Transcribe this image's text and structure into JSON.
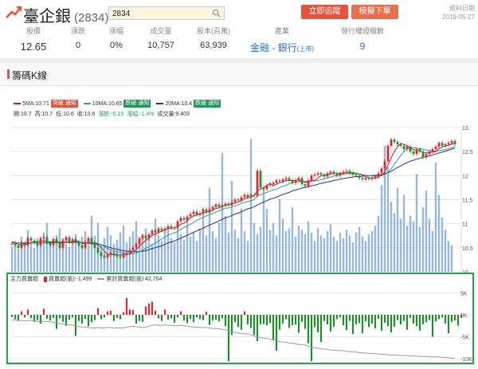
{
  "header": {
    "stock_name": "臺企銀",
    "stock_code": "(2834)",
    "search_value": "2834",
    "track_button": "立即追蹤",
    "trade_button": "模擬下單",
    "data_date_label": "資料日期",
    "data_date": "2019-05-27"
  },
  "stats": [
    {
      "label": "股價",
      "value": "12.65"
    },
    {
      "label": "漲跌",
      "value": "0"
    },
    {
      "label": "漲幅",
      "value": "0%"
    },
    {
      "label": "成交量",
      "value": "10,757"
    },
    {
      "label": "股本(百萬)",
      "value": "63,939"
    }
  ],
  "industry": {
    "label": "產業",
    "sector": "金融",
    "sep": " - ",
    "sub": "銀行",
    "market": "(上市)"
  },
  "warrants": {
    "label": "發行權證檔數",
    "value": "9"
  },
  "section_title": "籌碼K線",
  "legend": {
    "ma5": "5MA:10.71",
    "ma5_tag": "突破 通知",
    "ma10": "10MA:10.65",
    "ma10_tag": "跌破 通知",
    "ma20": "20MA:10.4",
    "ma20_tag": "跌破 通知"
  },
  "info": {
    "open": "開:10.7",
    "high": "高:10.7",
    "low": "低:10.6",
    "close": "收:10.6",
    "change": "漲跌:-0.15",
    "pct": "漲幅:-1.4%",
    "volume": "成交量:9,403"
  },
  "bottom_legend": {
    "main": "主力買賣超",
    "daily": "買賣超(張):-1,499",
    "cumulative": "累計買賣超(張):42,704"
  },
  "colors": {
    "up": "#e3262d",
    "down": "#1f8f2e",
    "ma5": "#b22222",
    "ma10": "#2fa29a",
    "ma20": "#2a2d9a",
    "volume": "#9ab8d8",
    "frame": "#22a447",
    "brand": "#e5533d"
  },
  "chart_data": {
    "type": "candlestick",
    "price_axis": {
      "ticks": [
        "13",
        "12.5",
        "12",
        "11.5",
        "11",
        "10.5",
        "10"
      ],
      "ylim": [
        10,
        13
      ]
    },
    "flow_axis": {
      "ticks": [
        "5K",
        "0K",
        "-5K",
        "-10K"
      ],
      "ylim": [
        -10000,
        6000
      ]
    },
    "close": [
      10.58,
      10.55,
      10.5,
      10.6,
      10.55,
      10.7,
      10.65,
      10.6,
      10.55,
      10.7,
      10.72,
      10.6,
      10.55,
      10.68,
      10.6,
      10.5,
      10.65,
      10.72,
      10.6,
      10.68,
      10.62,
      10.55,
      10.5,
      10.62,
      10.7,
      10.6,
      10.5,
      10.4,
      10.33,
      10.3,
      10.35,
      10.4,
      10.36,
      10.32,
      10.3,
      10.38,
      10.4,
      10.45,
      10.5,
      10.58,
      10.7,
      10.75,
      10.7,
      10.78,
      10.86,
      10.82,
      10.9,
      10.86,
      10.9,
      10.95,
      10.9,
      10.92,
      11.05,
      11.12,
      11.08,
      11.15,
      11.2,
      11.25,
      11.18,
      11.22,
      11.3,
      11.25,
      11.3,
      11.35,
      11.4,
      11.35,
      11.38,
      11.42,
      11.4,
      11.45,
      11.5,
      11.48,
      11.55,
      11.6,
      11.55,
      11.6,
      11.58,
      12.1,
      11.75,
      11.72,
      11.8,
      11.82,
      11.85,
      11.9,
      11.88,
      11.92,
      11.95,
      11.9,
      11.85,
      11.9,
      11.95,
      11.82,
      11.78,
      11.9,
      12.0,
      12.02,
      12.05,
      12.02,
      11.98,
      12.05,
      12.08,
      12.05,
      12.0,
      12.05,
      12.08,
      12.1,
      12.06,
      12.02,
      12.0,
      11.95,
      11.92,
      11.95,
      11.93,
      11.95,
      11.98,
      12.05,
      12.15,
      12.3,
      12.62,
      12.75,
      12.7,
      12.65,
      12.62,
      12.55,
      12.6,
      12.5,
      12.45,
      12.55,
      12.5,
      12.38,
      12.45,
      12.5,
      12.55,
      12.6,
      12.68,
      12.62,
      12.65,
      12.68,
      12.72,
      12.65
    ],
    "volume_k": [
      1.8,
      2.2,
      1.6,
      2.5,
      1.9,
      3.0,
      2.1,
      1.7,
      2.4,
      2.0,
      2.8,
      3.5,
      2.2,
      1.9,
      2.6,
      3.1,
      2.4,
      2.0,
      1.8,
      2.3,
      2.7,
      2.1,
      2.5,
      2.9,
      2.2,
      4.0,
      2.6,
      3.5,
      2.0,
      2.4,
      3.2,
      2.6,
      2.0,
      2.3,
      2.8,
      3.3,
      2.1,
      2.5,
      2.9,
      3.6,
      2.2,
      2.7,
      3.1,
      2.4,
      2.0,
      3.8,
      2.6,
      2.2,
      2.9,
      3.0,
      2.4,
      2.1,
      3.4,
      2.7,
      2.3,
      3.9,
      2.5,
      2.8,
      2.2,
      3.1,
      4.2,
      2.6,
      6.0,
      2.9,
      2.4,
      3.5,
      8.5,
      4.0,
      2.8,
      6.5,
      3.0,
      2.4,
      4.5,
      2.9,
      2.2,
      9.5,
      3.5,
      2.7,
      3.2,
      6.0,
      4.5,
      3.0,
      3.5,
      2.6,
      5.2,
      3.8,
      2.9,
      3.1,
      4.6,
      2.5,
      3.3,
      3.0,
      2.7,
      3.6,
      2.8,
      2.2,
      3.1,
      2.6,
      2.4,
      2.9,
      3.4,
      2.5,
      2.2,
      2.8,
      2.4,
      3.0,
      2.6,
      2.1,
      2.8,
      3.2,
      2.5,
      2.2,
      2.7,
      2.9,
      3.3,
      4.0,
      6.2,
      9.0,
      7.5,
      5.0,
      4.2,
      6.0,
      3.8,
      5.5,
      3.3,
      4.0,
      3.6,
      7.0,
      3.2,
      4.6,
      5.8,
      3.8,
      2.9,
      7.8,
      5.5,
      3.9,
      3.0,
      2.2,
      1.9
    ],
    "ma5": [
      10.62,
      10.6,
      10.57,
      10.56,
      10.56,
      10.58,
      10.61,
      10.62,
      10.63,
      10.64,
      10.64,
      10.63,
      10.62,
      10.63,
      10.63,
      10.59,
      10.6,
      10.62,
      10.61,
      10.63,
      10.65,
      10.63,
      10.59,
      10.59,
      10.6,
      10.58,
      10.58,
      10.56,
      10.51,
      10.43,
      10.36,
      10.36,
      10.35,
      10.35,
      10.35,
      10.35,
      10.35,
      10.38,
      10.42,
      10.46,
      10.53,
      10.6,
      10.65,
      10.7,
      10.76,
      10.78,
      10.82,
      10.84,
      10.87,
      10.9,
      10.91,
      10.91,
      10.94,
      10.99,
      11.01,
      11.06,
      11.12,
      11.16,
      11.18,
      11.2,
      11.23,
      11.24,
      11.25,
      11.28,
      11.32,
      11.33,
      11.36,
      11.38,
      11.39,
      11.4,
      11.43,
      11.45,
      11.48,
      11.52,
      11.54,
      11.56,
      11.58,
      11.69,
      11.72,
      11.75,
      11.79,
      11.84,
      11.79,
      11.82,
      11.85,
      11.87,
      11.9,
      11.9,
      11.9,
      11.9,
      11.91,
      11.88,
      11.86,
      11.87,
      11.89,
      11.9,
      11.95,
      12.0,
      12.01,
      12.02,
      12.04,
      12.04,
      12.04,
      12.05,
      12.05,
      12.06,
      12.06,
      12.06,
      12.05,
      12.03,
      12.01,
      11.98,
      11.95,
      11.95,
      11.95,
      11.97,
      12.01,
      12.07,
      12.22,
      12.37,
      12.5,
      12.6,
      12.67,
      12.65,
      12.62,
      12.58,
      12.54,
      12.53,
      12.52,
      12.48,
      12.47,
      12.48,
      12.49,
      12.5,
      12.56,
      12.59,
      12.62,
      12.63,
      12.66,
      12.66
    ],
    "ma10": [
      10.62,
      10.61,
      10.6,
      10.59,
      10.58,
      10.59,
      10.6,
      10.6,
      10.6,
      10.6,
      10.61,
      10.61,
      10.62,
      10.63,
      10.63,
      10.62,
      10.62,
      10.62,
      10.62,
      10.62,
      10.62,
      10.62,
      10.6,
      10.6,
      10.61,
      10.61,
      10.61,
      10.59,
      10.56,
      10.52,
      10.48,
      10.46,
      10.44,
      10.42,
      10.41,
      10.39,
      10.37,
      10.37,
      10.38,
      10.39,
      10.42,
      10.45,
      10.49,
      10.52,
      10.56,
      10.6,
      10.64,
      10.68,
      10.72,
      10.76,
      10.79,
      10.81,
      10.84,
      10.88,
      10.92,
      10.95,
      10.99,
      11.03,
      11.07,
      11.1,
      11.13,
      11.16,
      11.19,
      11.21,
      11.24,
      11.27,
      11.29,
      11.32,
      11.33,
      11.35,
      11.37,
      11.39,
      11.42,
      11.44,
      11.46,
      11.48,
      11.5,
      11.58,
      11.6,
      11.63,
      11.65,
      11.68,
      11.7,
      11.72,
      11.75,
      11.78,
      11.8,
      11.83,
      11.85,
      11.86,
      11.88,
      11.88,
      11.88,
      11.89,
      11.89,
      11.89,
      11.9,
      11.92,
      11.93,
      11.95,
      11.97,
      11.99,
      12.0,
      12.02,
      12.03,
      12.04,
      12.04,
      12.04,
      12.04,
      12.03,
      12.02,
      12.01,
      12.0,
      11.99,
      11.99,
      11.99,
      12.0,
      12.02,
      12.07,
      12.14,
      12.24,
      12.33,
      12.42,
      12.5,
      12.56,
      12.58,
      12.58,
      12.57,
      12.56,
      12.55,
      12.53,
      12.52,
      12.51,
      12.51,
      12.52,
      12.53,
      12.54,
      12.56,
      12.58,
      12.6
    ],
    "ma20": [
      10.6,
      10.6,
      10.6,
      10.6,
      10.6,
      10.6,
      10.6,
      10.6,
      10.6,
      10.6,
      10.6,
      10.6,
      10.6,
      10.6,
      10.61,
      10.61,
      10.61,
      10.61,
      10.61,
      10.61,
      10.61,
      10.61,
      10.61,
      10.61,
      10.6,
      10.6,
      10.59,
      10.58,
      10.56,
      10.54,
      10.52,
      10.5,
      10.48,
      10.47,
      10.45,
      10.44,
      10.43,
      10.42,
      10.42,
      10.42,
      10.42,
      10.43,
      10.44,
      10.46,
      10.48,
      10.5,
      10.52,
      10.54,
      10.57,
      10.6,
      10.62,
      10.64,
      10.67,
      10.7,
      10.73,
      10.76,
      10.79,
      10.82,
      10.85,
      10.88,
      10.91,
      10.94,
      10.97,
      11.0,
      11.03,
      11.06,
      11.09,
      11.12,
      11.14,
      11.17,
      11.2,
      11.22,
      11.25,
      11.28,
      11.31,
      11.33,
      11.35,
      11.39,
      11.42,
      11.45,
      11.48,
      11.51,
      11.53,
      11.55,
      11.58,
      11.61,
      11.63,
      11.65,
      11.68,
      11.7,
      11.72,
      11.74,
      11.75,
      11.77,
      11.79,
      11.8,
      11.82,
      11.84,
      11.85,
      11.87,
      11.88,
      11.9,
      11.91,
      11.93,
      11.94,
      11.95,
      11.96,
      11.97,
      11.98,
      11.98,
      11.99,
      11.99,
      12.0,
      12.0,
      12.01,
      12.01,
      12.02,
      12.04,
      12.06,
      12.09,
      12.13,
      12.17,
      12.2,
      12.24,
      12.27,
      12.3,
      12.32,
      12.34,
      12.36,
      12.38,
      12.39,
      12.41,
      12.43,
      12.45,
      12.47,
      12.49,
      12.51,
      12.53,
      12.55,
      12.57
    ],
    "flow_k": [
      -0.5,
      -1.0,
      -1.4,
      0.8,
      -0.6,
      1.2,
      -0.8,
      -1.6,
      -1.2,
      -2.0,
      1.4,
      -0.9,
      -1.3,
      -0.7,
      -3.2,
      -0.8,
      -1.6,
      -2.5,
      -1.1,
      -0.6,
      -4.8,
      -1.4,
      -2.0,
      -0.9,
      -2.6,
      -1.7,
      -1.2,
      1.5,
      -1.0,
      -0.6,
      0.8,
      0.9,
      -1.4,
      -0.7,
      -1.0,
      0.6,
      3.8,
      1.2,
      1.1,
      -2.0,
      -1.4,
      -1.6,
      1.9,
      2.6,
      3.0,
      0.9,
      -0.8,
      -1.4,
      1.2,
      -1.1,
      -0.8,
      -1.8,
      -0.6,
      0.8,
      -1.3,
      -1.9,
      -0.9,
      -1.7,
      -0.6,
      -1.0,
      -1.2,
      0.7,
      -2.3,
      -1.3,
      -1.1,
      -1.5,
      -0.8,
      -2.6,
      -10.6,
      -4.6,
      -1.7,
      -2.8,
      -3.4,
      0.8,
      -2.2,
      -3.0,
      -4.6,
      -6.0,
      -2.2,
      -2.1,
      -2.4,
      -1.9,
      -5.8,
      -8.2,
      -3.4,
      -2.0,
      -1.0,
      -3.0,
      -2.4,
      -2.2,
      -4.1,
      -1.6,
      -3.2,
      -6.5,
      -10.6,
      -2.8,
      -4.0,
      -6.2,
      -1.4,
      -2.2,
      -3.8,
      -2.7,
      -1.0,
      -0.6,
      -2.4,
      -3.5,
      -1.4,
      -4.4,
      -2.2,
      -1.9,
      -4.2,
      -1.5,
      -2.8,
      -2.0,
      -3.1,
      -0.9,
      -3.6,
      -1.8,
      -2.6,
      -4.0,
      -2.7,
      -1.2,
      -2.2,
      -1.4,
      -3.4,
      -0.7,
      -2.0,
      -2.6,
      -3.6,
      -2.2,
      -1.7,
      -1.2,
      -5.0,
      -1.5,
      -1.0,
      -0.6,
      -2.0,
      -4.2,
      -1.6,
      -1.3,
      -2.5,
      -0.7
    ],
    "cumulative_k": [
      -1.2,
      -1.2,
      -1.3,
      -1.3,
      -1.4,
      -1.3,
      -1.3,
      -1.4,
      -1.5,
      -1.6,
      -1.5,
      -1.5,
      -1.6,
      -1.7,
      -1.9,
      -2.0,
      -2.1,
      -2.2,
      -2.3,
      -2.3,
      -2.6,
      -2.7,
      -2.8,
      -2.8,
      -2.9,
      -3.0,
      -3.0,
      -2.9,
      -3.0,
      -3.0,
      -2.9,
      -2.9,
      -3.0,
      -3.0,
      -3.0,
      -3.0,
      -2.8,
      -2.7,
      -2.6,
      -2.7,
      -2.8,
      -2.9,
      -2.8,
      -2.6,
      -2.4,
      -2.3,
      -2.4,
      -2.4,
      -2.3,
      -2.4,
      -2.4,
      -2.5,
      -2.5,
      -2.4,
      -2.5,
      -2.6,
      -2.7,
      -2.8,
      -2.8,
      -2.9,
      -2.9,
      -2.9,
      -3.0,
      -3.1,
      -3.1,
      -3.2,
      -3.3,
      -3.4,
      -3.7,
      -3.9,
      -4.0,
      -4.1,
      -4.3,
      -4.3,
      -4.4,
      -4.6,
      -4.8,
      -5.1,
      -5.2,
      -5.3,
      -5.4,
      -5.5,
      -5.7,
      -6.0,
      -6.1,
      -6.2,
      -6.3,
      -6.4,
      -6.5,
      -6.6,
      -6.8,
      -6.8,
      -6.9,
      -7.1,
      -7.4,
      -7.5,
      -7.6,
      -7.8,
      -7.8,
      -7.9,
      -8.0,
      -8.1,
      -8.1,
      -8.2,
      -8.2,
      -8.3,
      -8.4,
      -8.5,
      -8.5,
      -8.6,
      -8.7,
      -8.7,
      -8.8,
      -8.8,
      -8.9,
      -8.9,
      -9.0,
      -9.0,
      -9.1,
      -9.2,
      -9.2,
      -9.2,
      -9.3,
      -9.3,
      -9.3,
      -9.4,
      -9.4,
      -9.4,
      -9.5,
      -9.5,
      -9.5,
      -9.6,
      -9.6,
      -9.6,
      -9.6,
      -9.7,
      -9.7,
      -9.8,
      -9.9,
      -9.9
    ]
  }
}
